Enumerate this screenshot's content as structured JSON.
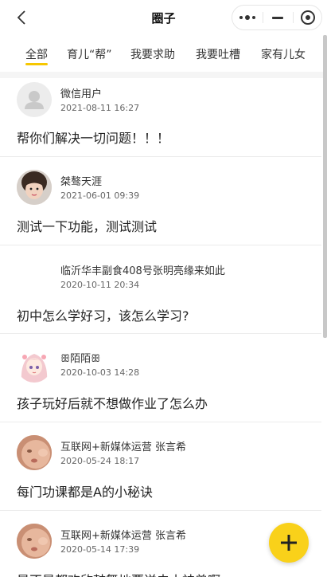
{
  "nav": {
    "title": "圈子"
  },
  "tabs": [
    {
      "label": "全部",
      "active": true
    },
    {
      "label": "育儿“帮”",
      "active": false
    },
    {
      "label": "我要求助",
      "active": false
    },
    {
      "label": "我要吐槽",
      "active": false
    },
    {
      "label": "家有儿女",
      "active": false
    }
  ],
  "posts": [
    {
      "user": "微信用户",
      "time": "2021-08-11 16:27",
      "content": "帮你们解决一切问题！！！",
      "avatar": "default-avatar-icon"
    },
    {
      "user": "桀骜天涯",
      "time": "2021-06-01 09:39",
      "content": "测试一下功能，测试测试",
      "avatar": "girl-photo-avatar"
    },
    {
      "user": "临沂华丰副食408号张明亮缘来如此",
      "time": "2020-10-11 20:34",
      "content": "初中怎么学好习，该怎么学习?",
      "avatar": "blank-avatar"
    },
    {
      "user": "ꕥ陌陌ꕥ",
      "time": "2020-10-03 14:28",
      "content": "孩子玩好后就不想做作业了怎么办",
      "avatar": "anime-girl-avatar"
    },
    {
      "user": "互联网+新媒体运营 张言希",
      "time": "2020-05-24 18:17",
      "content": "每门功课都是A的小秘诀",
      "avatar": "baby-face-avatar"
    },
    {
      "user": "互联网+新媒体运营 张言希",
      "time": "2020-05-14 17:39",
      "content": "是不是都欢欣鼓舞地要送去小神兽啊",
      "avatar": "baby-face-avatar"
    }
  ],
  "colors": {
    "accent": "#f9d11a",
    "underline": "#f6c700"
  }
}
